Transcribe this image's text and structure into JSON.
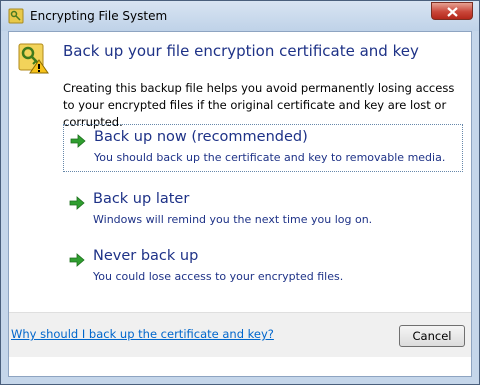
{
  "window": {
    "title": "Encrypting File System",
    "close_icon": "close-icon"
  },
  "header": {
    "icon": "key-warning-icon",
    "heading": "Back up your file encryption certificate and key",
    "description": "Creating this backup file helps you avoid permanently losing access to your encrypted files if the original certificate and key are lost or corrupted."
  },
  "options": [
    {
      "title": "Back up now (recommended)",
      "description": "You should back up the certificate and key to removable media.",
      "icon": "green-arrow-icon",
      "focused": true
    },
    {
      "title": "Back up later",
      "description": "Windows will remind you the next time you log on.",
      "icon": "green-arrow-icon"
    },
    {
      "title": "Never back up",
      "description": "You could lose access to your encrypted files.",
      "icon": "green-arrow-icon"
    }
  ],
  "footer": {
    "cancel_label": "Cancel",
    "help_link": "Why should I back up the certificate and key?"
  },
  "colors": {
    "title_blue": "#1e3287",
    "link_blue": "#0066cc",
    "arrow_green": "#2f9e2f"
  }
}
